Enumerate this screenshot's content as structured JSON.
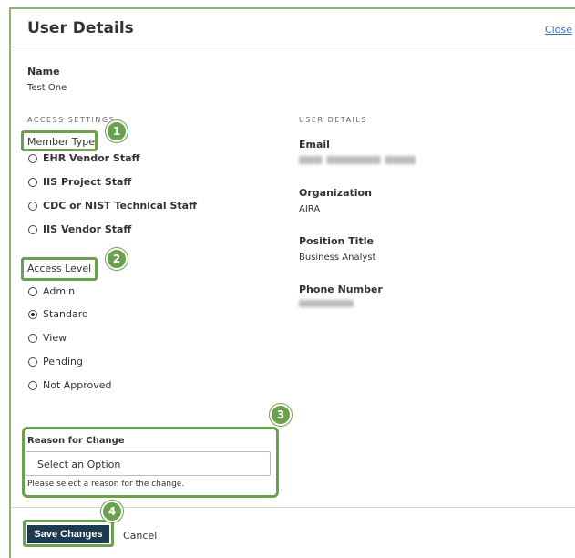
{
  "header": {
    "title": "User Details",
    "close_label": "Close"
  },
  "name": {
    "label": "Name",
    "value": "Test One"
  },
  "access_settings": {
    "section_label": "ACCESS SETTINGS",
    "member_type": {
      "label": "Member Type",
      "options": [
        "EHR Vendor Staff",
        "IIS Project Staff",
        "CDC or NIST Technical Staff",
        "IIS Vendor Staff"
      ]
    },
    "access_level": {
      "label": "Access Level",
      "options": [
        "Admin",
        "Standard",
        "View",
        "Pending",
        "Not Approved"
      ],
      "selected": "Standard"
    }
  },
  "user_details": {
    "section_label": "USER DETAILS",
    "email": {
      "label": "Email",
      "value": ""
    },
    "organization": {
      "label": "Organization",
      "value": "AIRA"
    },
    "position_title": {
      "label": "Position Title",
      "value": "Business Analyst"
    },
    "phone_number": {
      "label": "Phone Number",
      "value": ""
    }
  },
  "reason": {
    "label": "Reason for Change",
    "placeholder": "Select an Option",
    "help_text": "Please select a reason for the change."
  },
  "footer": {
    "save_label": "Save Changes",
    "cancel_label": "Cancel"
  },
  "badges": [
    "1",
    "2",
    "3",
    "4"
  ],
  "colors": {
    "highlight": "#6ba04e",
    "save_button": "#1e3a4f",
    "link": "#3c6fb4"
  }
}
